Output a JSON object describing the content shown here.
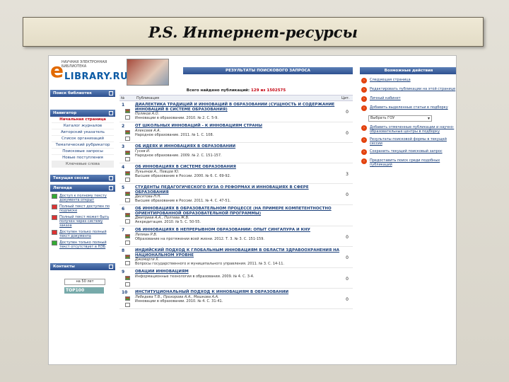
{
  "slide_title": "P.S. Интернет-ресурсы",
  "logo": {
    "tagline": "НАУЧНАЯ ЭЛЕКТРОННАЯ БИБЛИОТЕКА",
    "name": "LIBRARY.RU",
    "letter": "e"
  },
  "left": {
    "search_header": "Поиск библиотек",
    "nav_header": "Навигатор",
    "nav_items": [
      {
        "label": "Начальная страница",
        "active": true
      },
      {
        "label": "Каталог журналов"
      },
      {
        "label": "Авторский указатель"
      },
      {
        "label": "Список организаций"
      },
      {
        "label": "Тематический рубрикатор"
      },
      {
        "label": "Поисковые запросы"
      },
      {
        "label": "Новые поступления"
      },
      {
        "label": "Ключевые слова",
        "grey": true
      }
    ],
    "session_header": "Текущая сессия",
    "legend_header": "Легенда",
    "legend_items": [
      {
        "label": "Доступ к полному тексту документа открыт",
        "color": "green"
      },
      {
        "label": "Полный текст доступен по подписке",
        "color": "red"
      },
      {
        "label": "Полный текст может быть получен через систему заказа",
        "color": "red"
      },
      {
        "label": "Доступен только полный текст документа",
        "color": "red"
      },
      {
        "label": "Доступен только полный текст отсутствует в НЭБ",
        "color": "green"
      }
    ],
    "contacts_header": "Контакты",
    "counter_label": "на 50 лет",
    "counter_value": "TOP100"
  },
  "center": {
    "header": "РЕЗУЛЬТАТЫ ПОИСКОВОГО ЗАПРОСА",
    "found_prefix": "Всего найдено публикаций:",
    "found_count": "129 из 1502575",
    "col_num": "№",
    "col_title": "Публикация",
    "col_cit": "Цит.",
    "rows": [
      {
        "n": "1",
        "title": "ДИАЛЕКТИКА ТРАДИЦИЙ И ИННОВАЦИЙ В ОБРАЗОВАНИИ (СУЩНОСТЬ И СОДЕРЖАНИЕ ИННОВАЦИЙ В СИСТЕМЕ ОБРАЗОВАНИЯ)",
        "author": "Поляков А.О.",
        "source": "Инновации в образовании. 2010. № 2. С. 5-9.",
        "cit": "0"
      },
      {
        "n": "2",
        "title": "ОТ ШКОЛЬНЫХ ИННОВАЦИЙ - К ИННОВАЦИЯМ СТРАНЫ",
        "author": "Алексеев А.А.",
        "source": "Народное образование. 2011. № 1. С. 108.",
        "cit": "0"
      },
      {
        "n": "3",
        "title": "ОБ ИДЕЯХ И ИННОВАЦИЯХ В ОБРАЗОВАНИИ",
        "author": "Гусев И.",
        "source": "Народное образование. 2009. № 2. С. 151-157.",
        "cit": ""
      },
      {
        "n": "4",
        "title": "ОБ ИННОВАЦИЯХ В СИСТЕМЕ ОБРАЗОВАНИЯ",
        "author": "Лукьянов А., Певцов Ю.",
        "source": "Высшее образование в России. 2000. № 6. С. 69-92.",
        "cit": "3"
      },
      {
        "n": "5",
        "title": "СТУДЕНТЫ ПЕДАГОГИЧЕСКОГО ВУЗА О РЕФОРМАХ И ИННОВАЦИЯХ В СФЕРЕ ОБРАЗОВАНИЯ",
        "author": "Десятова Н.Н.",
        "source": "Высшее образование в России. 2011. № 4. С. 47-51.",
        "cit": "0"
      },
      {
        "n": "6",
        "title": "ОБ ИННОВАЦИЯХ В ОБРАЗОВАТЕЛЬНОМ ПРОЦЕССЕ (НА ПРИМЕРЕ КОМПЕТЕНТНОСТНО ОРИЕНТИРОВАННОЙ ОБРАЗОВАТЕЛЬНОЙ ПРОГРАММЫ)",
        "author": "Дмитриев А.А., Полтева Ж.В.",
        "source": "Аккредитация. 2010. № 5. С. 50-55.",
        "cit": ""
      },
      {
        "n": "7",
        "title": "ОБ ИННОВАЦИЯХ В НЕПРЕРЫВНОМ ОБРАЗОВАНИИ: ОПЫТ СИНГАПУРА И КНУ",
        "author": "Лепман Р.В.",
        "source": "Образование на протяжении всей жизни. 2012. Т. 3. № 3. С. 151-159.",
        "cit": "0"
      },
      {
        "n": "8",
        "title": "ИНДИЙСКИЙ ПОДХОД К ГЛОБАЛЬНЫМ ИННОВАЦИЯМ В ОБЛАСТИ ЗДРАВООХРАНЕНИЯ НА НАЦИОНАЛЬНОМ УРОВНЕ",
        "author": "Джоморти Х.",
        "source": "Вопросы государственного и муниципального управления. 2011. № 3. С. 14-11.",
        "cit": "0"
      },
      {
        "n": "9",
        "title": "ОВАЦИИ ИННОВАЦИЯМ",
        "author": "",
        "source": "Информационные технологии в образовании. 2009. № 4. С. 3-4.",
        "cit": "0"
      },
      {
        "n": "10",
        "title": "ИНСТИТУЦИОНАЛЬНЫЙ ПОДХОД К ИННОВАЦИЯМ В ОБРАЗОВАНИИ",
        "author": "Лебедева Т.В., Прохорова А.А., Мешкова А.А.",
        "source": "Инновации в образовании. 2010. № 4. С. 31-41.",
        "cit": "0"
      }
    ]
  },
  "right": {
    "header": "Возможные действия",
    "actions": [
      {
        "label": "Следующая страница"
      },
      {
        "label": "Редактировать публикации на этой странице"
      },
      {
        "label": "Личный кабинет"
      },
      {
        "label": "Добавить выделенные статьи в подборку"
      }
    ],
    "select_value": "Выбрать ГОУ",
    "actions2": [
      {
        "label": "Добавить отмеченные публикации и научно-образовательные центры в подборку"
      },
      {
        "label": "Результаты поисковой формы в текущей сессии"
      },
      {
        "label": "Сохранить текущий поисковый запрос"
      },
      {
        "label": "Предоставить поиск среди подобных публикаций"
      }
    ]
  }
}
